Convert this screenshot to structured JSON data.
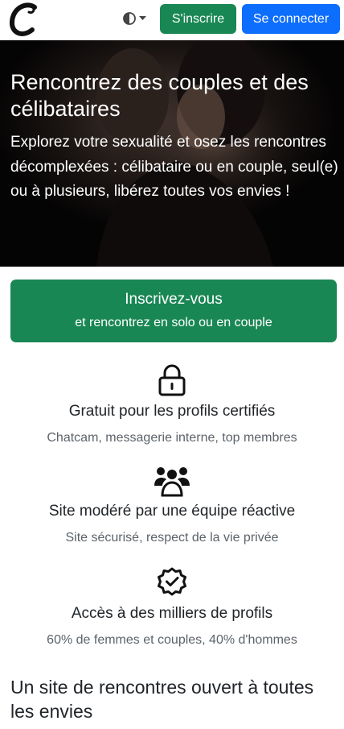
{
  "header": {
    "logo_alt": "C",
    "theme_toggle_icon": "contrast-icon",
    "signup_label": "S'inscrire",
    "login_label": "Se connecter"
  },
  "hero": {
    "title": "Rencontrez des couples et des célibataires",
    "text": "Explorez votre sexualité et osez les rencontres décomplexées : célibataire ou en couple, seul(e) ou à plusieurs, libérez toutes vos envies !"
  },
  "cta": {
    "line1": "Inscrivez-vous",
    "line2": "et rencontrez en solo ou en couple"
  },
  "features": [
    {
      "icon": "lock-icon",
      "title": "Gratuit pour les profils certifiés",
      "subtitle": "Chatcam, messagerie interne, top membres"
    },
    {
      "icon": "people-icon",
      "title": "Site modéré par une équipe réactive",
      "subtitle": "Site sécurisé, respect de la vie privée"
    },
    {
      "icon": "check-badge-icon",
      "title": "Accès à des milliers de profils",
      "subtitle": "60% de femmes et couples, 40% d'hommes"
    }
  ],
  "section": {
    "title": "Un site de rencontres ouvert à toutes les envies"
  },
  "colors": {
    "success": "#198754",
    "primary": "#0d6efd",
    "text": "#212529",
    "muted": "#5c636a"
  }
}
